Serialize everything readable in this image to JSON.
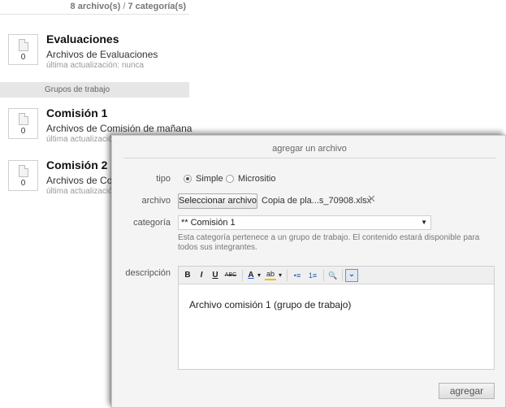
{
  "summary": {
    "files": "8 archivo(s)",
    "separator": " / ",
    "categories": "7 categoría(s)"
  },
  "categories": [
    {
      "title": "Evaluaciones",
      "description": "Archivos de Evaluaciones",
      "update": "última actualización: nunca",
      "count": "0"
    },
    {
      "title": "Comisión 1",
      "description": "Archivos de Comisión de mañana",
      "update": "última actualizació",
      "count": "0"
    },
    {
      "title": "Comisión 2",
      "description": "Archivos de Com",
      "update": "última actualizació",
      "count": "0"
    }
  ],
  "group_header": "Grupos de trabajo",
  "dialog": {
    "title": "agregar un archivo",
    "tipo_label": "tipo",
    "tipo_options": [
      "Simple",
      "Micrositio"
    ],
    "tipo_selected": "Simple",
    "archivo_label": "archivo",
    "file_button": "Seleccionar archivo",
    "file_name": "Copia de pla...s_70908.xlsx",
    "file_clear": "✕",
    "categoria_label": "categoría",
    "categoria_value": "** Comisión 1",
    "categoria_note": "Esta categoría pertenece a un grupo de trabajo. El contenido estará disponible para todos sus integrantes.",
    "descripcion_label": "descripción",
    "toolbar": {
      "bold": "B",
      "italic": "I",
      "underline": "U",
      "strike": "ABC",
      "font_color": "A",
      "highlight": "ab",
      "dropdown": "▾",
      "bullet_list": "•≡",
      "numbered_list": "1≡",
      "preview": "🔍",
      "collapse": "⌄"
    },
    "editor_text": "Archivo comisión 1 (grupo de trabajo)",
    "submit": "agregar"
  }
}
